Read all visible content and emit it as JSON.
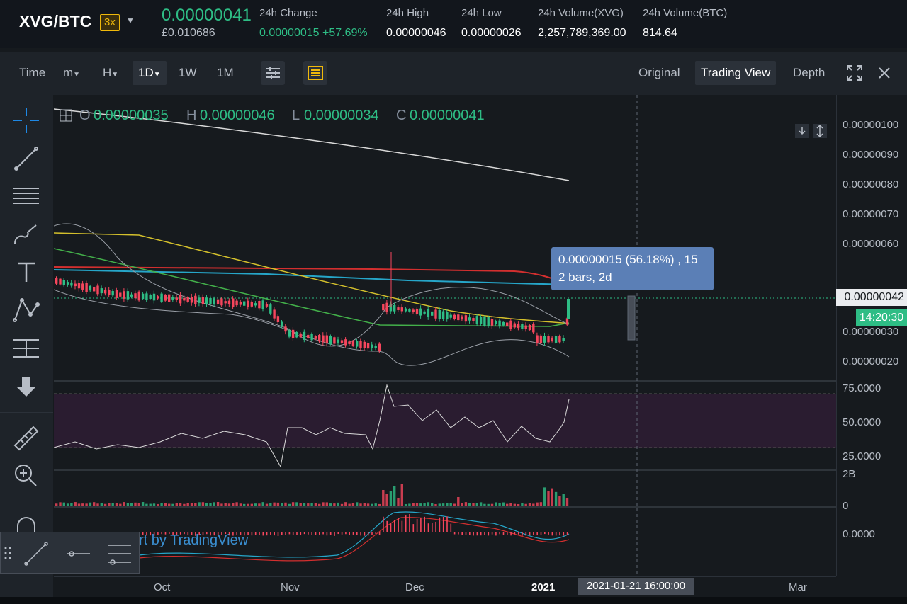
{
  "header": {
    "pair": "XVG/BTC",
    "leverage": "3x",
    "last_price": "0.00000041",
    "fiat_price": "£0.010686",
    "stats": [
      {
        "label": "24h Change",
        "value": "0.00000015 +57.69%",
        "color": "#2ebd85"
      },
      {
        "label": "24h High",
        "value": "0.00000046",
        "color": "#ffffff"
      },
      {
        "label": "24h Low",
        "value": "0.00000026",
        "color": "#ffffff"
      },
      {
        "label": "24h Volume(XVG)",
        "value": "2,257,789,369.00",
        "color": "#ffffff"
      },
      {
        "label": "24h Volume(BTC)",
        "value": "814.64",
        "color": "#ffffff"
      }
    ]
  },
  "toolbar": {
    "time_label": "Time",
    "intervals": [
      "m",
      "H",
      "1D",
      "1W",
      "1M"
    ],
    "active_interval": "1D",
    "view_tabs": [
      "Original",
      "Trading View",
      "Depth"
    ],
    "active_view": "Trading View",
    "icons": [
      "settings-sliders-icon",
      "indicators-icon",
      "fullscreen-icon",
      "close-icon"
    ]
  },
  "left_tools": [
    "crosshair-icon",
    "trend-line-icon",
    "fib-lines-icon",
    "brush-icon",
    "text-icon",
    "pattern-icon",
    "measure-lines-icon",
    "down-arrow-icon",
    "ruler-icon",
    "zoom-in-icon",
    "magnet-icon"
  ],
  "ohlc": {
    "o_label": "O",
    "o": "0.00000035",
    "h_label": "H",
    "h": "0.00000046",
    "l_label": "L",
    "l": "0.00000034",
    "c_label": "C",
    "c": "0.00000041"
  },
  "tooltip": {
    "line1": "0.00000015 (56.18%) , 15",
    "line2": "2 bars, 2d"
  },
  "price_axis": {
    "labels": [
      "0.00000100",
      "0.00000090",
      "0.00000080",
      "0.00000070",
      "0.00000060",
      "0.00000030",
      "0.00000020"
    ],
    "current_price": "0.00000042",
    "countdown": "14:20:30"
  },
  "rsi_axis": [
    "75.0000",
    "50.0000",
    "25.0000"
  ],
  "volume_axis": [
    "2B",
    "0"
  ],
  "macd_axis": [
    "0.0000"
  ],
  "time_axis": {
    "labels": [
      "Oct",
      "Nov",
      "Dec",
      "2021",
      "Mar"
    ],
    "crosshair_time": "2021-01-21 16:00:00"
  },
  "watermark": "rt by TradingView",
  "colors": {
    "up": "#2ebd85",
    "down": "#f6465d",
    "accent": "#f0b90b",
    "bg": "#161a1e",
    "panel": "#1e2329"
  }
}
